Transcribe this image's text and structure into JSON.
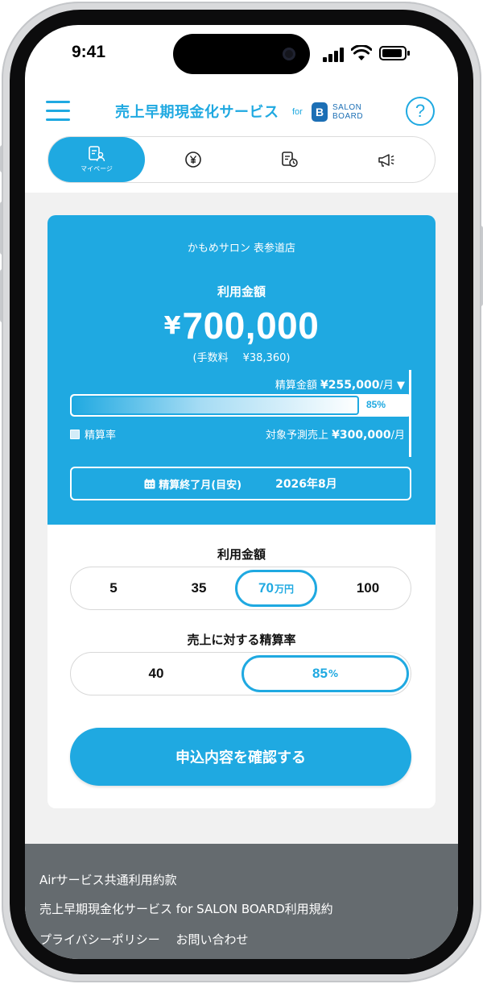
{
  "status_bar": {
    "time": "9:41"
  },
  "header": {
    "title": "売上早期現金化サービス",
    "title_for": "for",
    "logo_mark": "B",
    "logo_line1": "SALON",
    "logo_line2": "BOARD",
    "help_symbol": "?"
  },
  "tabs": [
    {
      "name": "mypage",
      "label": "マイページ",
      "icon": "person-document-icon",
      "active": true
    },
    {
      "name": "yen",
      "icon": "yen-icon",
      "active": false
    },
    {
      "name": "history",
      "icon": "document-clock-icon",
      "active": false
    },
    {
      "name": "announcements",
      "icon": "megaphone-icon",
      "active": false
    }
  ],
  "summary": {
    "store_name": "かもめサロン 表参道店",
    "usage_label": "利用金額",
    "amount_currency": "¥",
    "amount_value": "700,000",
    "fee_label": "(手数料",
    "fee_value": "¥38,360)",
    "monthly_label": "精算金額",
    "monthly_value": "¥255,000",
    "monthly_unit": "/月 ▼",
    "rate_percent": 85,
    "rate_percent_label": "85%",
    "rate_legend": "精算率",
    "target_label": "対象予測売上",
    "target_value": "¥300,000",
    "target_unit": "/月",
    "end_label": "精算終了月(目安)",
    "end_value": "2026年8月"
  },
  "amount_selector": {
    "title": "利用金額",
    "options": [
      {
        "value": "5",
        "unit": "",
        "selected": false
      },
      {
        "value": "35",
        "unit": "",
        "selected": false
      },
      {
        "value": "70",
        "unit": "万円",
        "selected": true
      },
      {
        "value": "100",
        "unit": "",
        "selected": false
      }
    ]
  },
  "rate_selector": {
    "title": "売上に対する精算率",
    "options": [
      {
        "value": "40",
        "unit": "",
        "selected": false
      },
      {
        "value": "85",
        "unit": "%",
        "selected": true
      }
    ]
  },
  "confirm_button_label": "申込内容を確認する",
  "footer_links": [
    "Airサービス共通利用約款",
    "売上早期現金化サービス for SALON BOARD利用規約",
    "プライバシーポリシー　 お問い合わせ"
  ],
  "colors": {
    "accent": "#1fa9e1",
    "footer_bg": "#656b6f",
    "content_bg": "#f1f1f1",
    "logo_blue": "#1c6fb5"
  }
}
